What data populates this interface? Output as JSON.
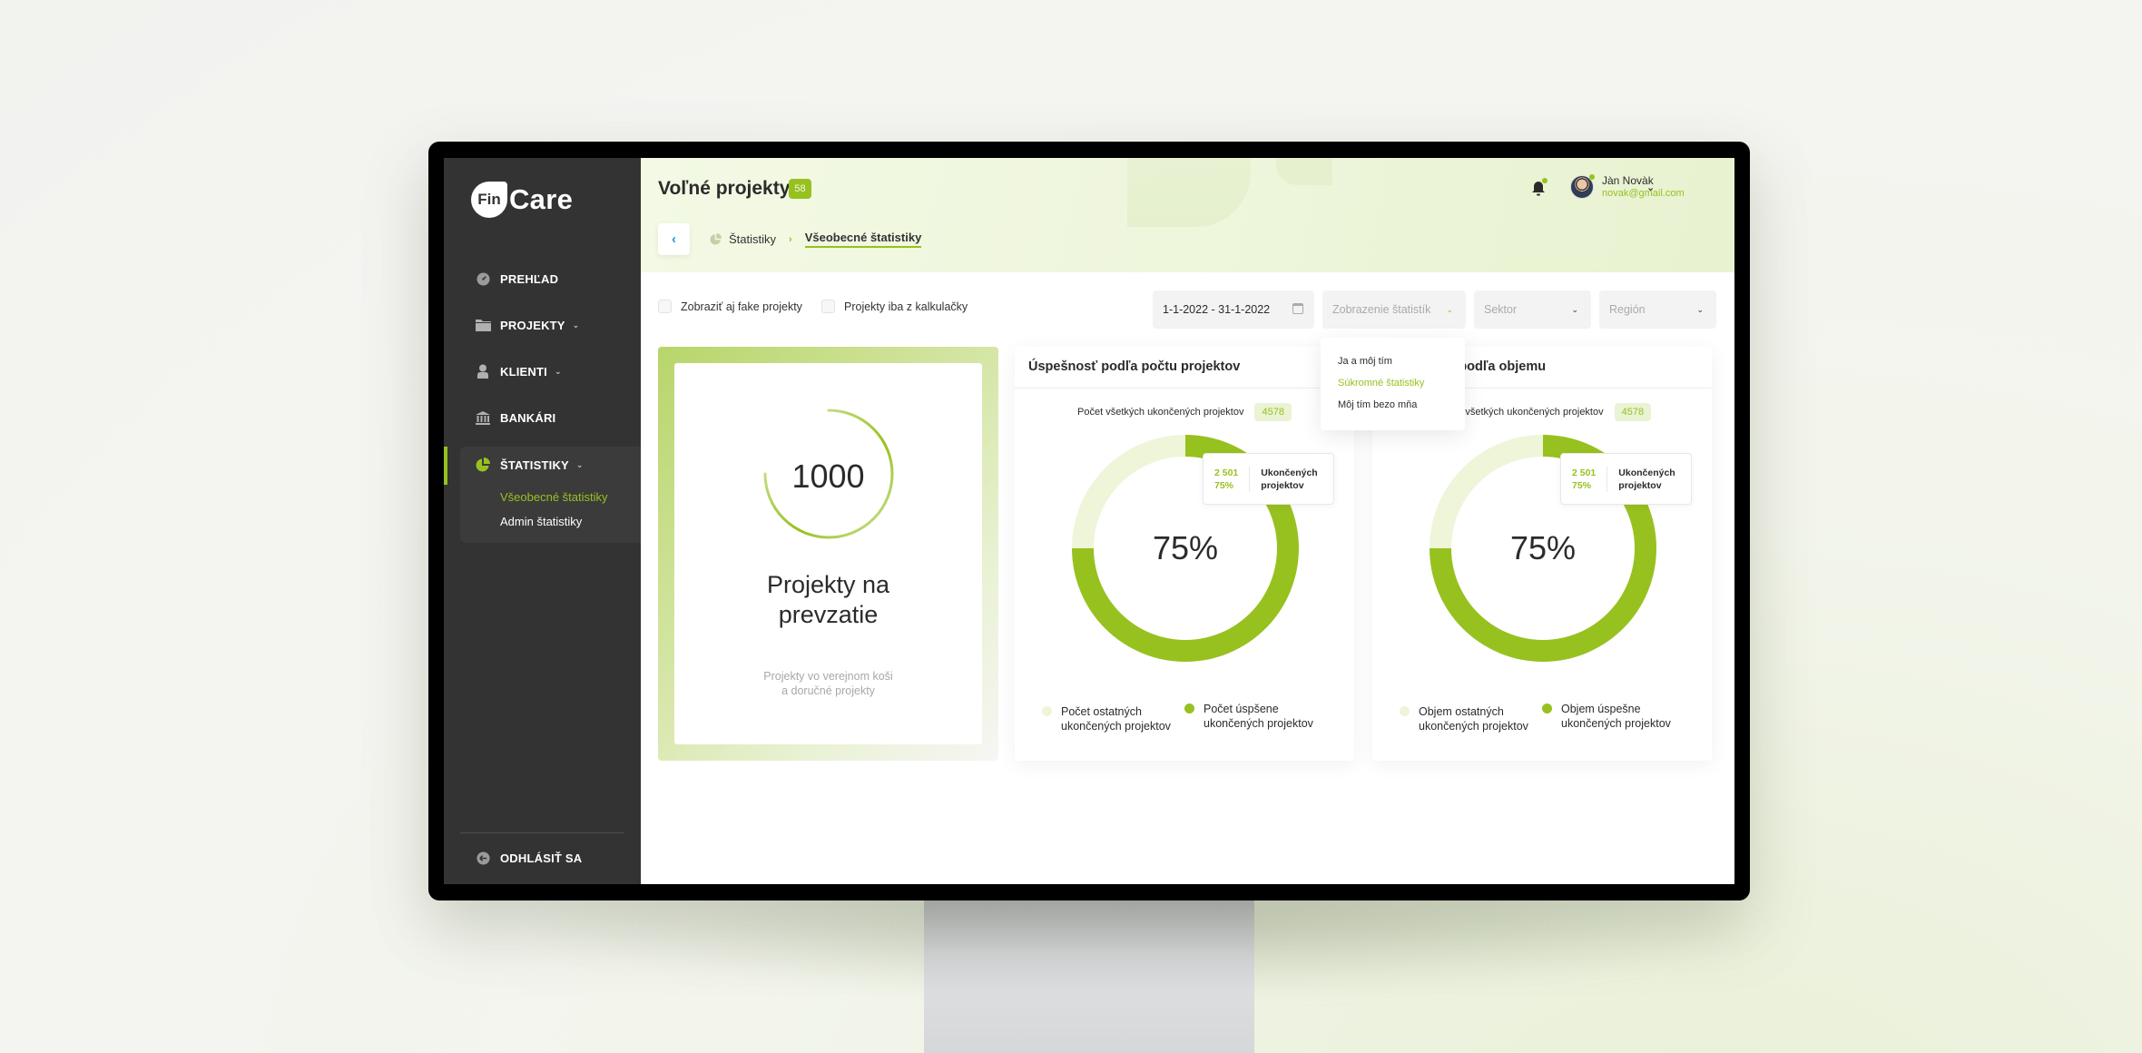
{
  "app": {
    "logo_badge": "Fin",
    "logo_text": "Care"
  },
  "sidebar": {
    "items": [
      {
        "label": "PREHĽAD",
        "icon": "dashboard-gauge-icon"
      },
      {
        "label": "PROJEKTY",
        "icon": "folder-icon",
        "has_children": true
      },
      {
        "label": "KLIENTI",
        "icon": "user-icon",
        "has_children": true
      },
      {
        "label": "BANKÁRI",
        "icon": "bank-icon"
      },
      {
        "label": "ŠTATISTIKY",
        "icon": "pie-chart-icon",
        "has_children": true,
        "active": true
      }
    ],
    "subitems": [
      {
        "label": "Všeobecné štatistiky",
        "active": true
      },
      {
        "label": "Admin štatistiky"
      }
    ],
    "logout_label": "ODHLÁSIŤ SA",
    "chevron": "⌄"
  },
  "header": {
    "title": "Voľné projekty",
    "count": "58",
    "back_icon": "‹",
    "breadcrumb": [
      {
        "label": "Štatistiky",
        "icon": "pie-chart-icon"
      },
      {
        "label": "Všeobecné štatistiky",
        "active": true
      }
    ],
    "breadcrumb_separator": "›",
    "user": {
      "name": "Jàn Novàk",
      "email": "novak@gmail.com"
    },
    "user_chevron": "⌄"
  },
  "filters": {
    "checkboxes": [
      {
        "label": "Zobraziť aj fake projekty",
        "checked": false
      },
      {
        "label": "Projekty iba z kalkulačky",
        "checked": false
      }
    ],
    "date_range": "1-1-2022 - 31-1-2022",
    "view_select": {
      "placeholder": "Zobrazenie štatistík",
      "open": true
    },
    "sector_select": {
      "placeholder": "Sektor"
    },
    "region_select": {
      "placeholder": "Región"
    },
    "chevron": "⌄",
    "view_options": [
      {
        "label": "Ja a môj tím"
      },
      {
        "label": "Súkromné štatistiky",
        "highlighted": true
      },
      {
        "label": "Môj tím bezo mňa"
      }
    ]
  },
  "hero": {
    "value": "1000",
    "ring_fraction": 0.75,
    "title_line1": "Projekty na",
    "title_line2": "prevzatie",
    "subtitle_line1": "Projekty vo verejnom koši",
    "subtitle_line2": "a doručné projekty"
  },
  "colors": {
    "accent": "#97c11f",
    "accent_light": "#eef5d9",
    "sidebar_bg": "#333333",
    "text": "#2b2b2b"
  },
  "cards": [
    {
      "title": "Úspešnosť podľa počtu projektov",
      "total_label": "Počet všetkých ukončených projektov",
      "total_value": "4578",
      "center_label": "75%",
      "tooltip": {
        "value": "2 501",
        "percent": "75%",
        "label_line1": "Ukončených",
        "label_line2": "projektov"
      },
      "legend": [
        {
          "line1": "Počet ostatných",
          "line2": "ukončených projektov",
          "color": "#eef5d9"
        },
        {
          "line1": "Počet úspšene",
          "line2": "ukončených projektov",
          "color": "#97c11f"
        }
      ]
    },
    {
      "title": "Úspešnosť podľa objemu",
      "total_label": "Objem všetkých ukončených projektov",
      "total_value": "4578",
      "center_label": "75%",
      "tooltip": {
        "value": "2 501",
        "percent": "75%",
        "label_line1": "Ukončených",
        "label_line2": "projektov"
      },
      "legend": [
        {
          "line1": "Objem ostatných",
          "line2": "ukončených projektov",
          "color": "#eef5d9"
        },
        {
          "line1": "Objem úspešne",
          "line2": "ukončených projektov",
          "color": "#97c11f"
        }
      ]
    }
  ],
  "chart_data": [
    {
      "type": "pie",
      "title": "Úspešnosť podľa počtu projektov",
      "categories": [
        "Počet úspšene ukončených projektov",
        "Počet ostatných ukončených projektov"
      ],
      "values": [
        75,
        25
      ],
      "unit": "%",
      "center_label": "75%",
      "tooltip": {
        "value": 2501,
        "percent": 75
      },
      "total": 4578,
      "legend": "bottom"
    },
    {
      "type": "pie",
      "title": "Úspešnosť podľa objemu",
      "categories": [
        "Objem úspešne ukončených projektov",
        "Objem ostatných ukončených projektov"
      ],
      "values": [
        75,
        25
      ],
      "unit": "%",
      "center_label": "75%",
      "tooltip": {
        "value": 2501,
        "percent": 75
      },
      "total": 4578,
      "legend": "bottom"
    }
  ]
}
